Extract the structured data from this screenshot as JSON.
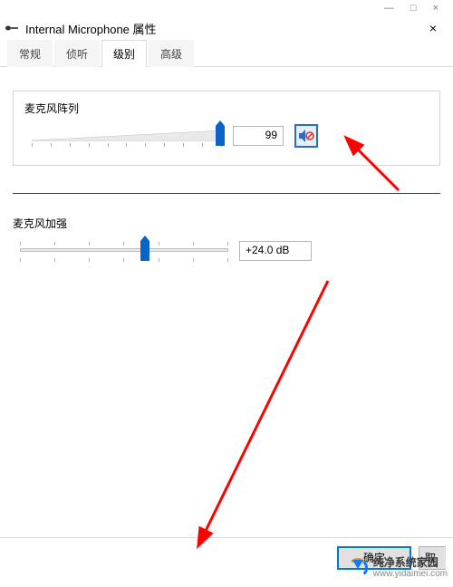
{
  "window": {
    "title": "Internal Microphone 属性",
    "min_icon": "—",
    "max_icon": "□",
    "close_icon": "×",
    "big_close": "×"
  },
  "tabs": [
    {
      "label": "常规",
      "active": false
    },
    {
      "label": "侦听",
      "active": false
    },
    {
      "label": "级别",
      "active": true
    },
    {
      "label": "高级",
      "active": false
    }
  ],
  "levels": {
    "mic_array": {
      "label": "麦克风阵列",
      "value": "99",
      "slider_percent": 99,
      "muted": true
    },
    "mic_boost": {
      "label": "麦克风加强",
      "value": "+24.0 dB",
      "slider_percent": 60
    }
  },
  "buttons": {
    "ok": "确定",
    "cancel": "取消"
  },
  "watermark": {
    "line1": "纯净系统家园",
    "line2": "www.yidaimei.com"
  },
  "colors": {
    "accent": "#0a64c8",
    "arrow": "#ff0000"
  }
}
